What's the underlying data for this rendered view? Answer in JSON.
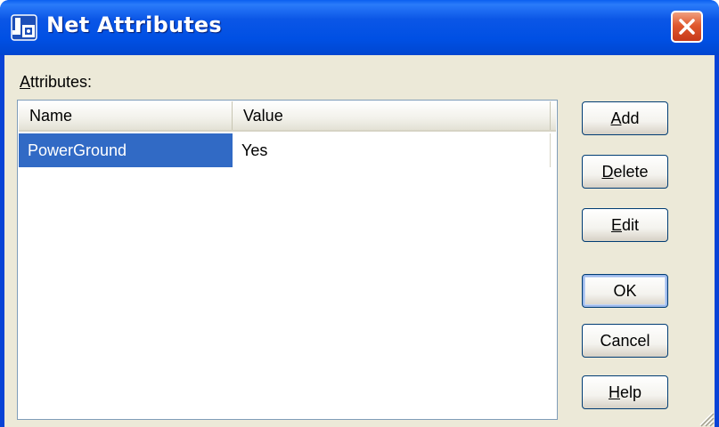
{
  "window": {
    "title": "Net Attributes",
    "app_icon": "app-icon",
    "close_icon": "close-icon"
  },
  "attributes_label": {
    "mnemonic": "A",
    "rest": "ttributes:"
  },
  "list": {
    "columns": [
      "Name",
      "Value"
    ],
    "rows": [
      {
        "name": "PowerGround",
        "value": "Yes",
        "selected": true
      }
    ]
  },
  "buttons": {
    "add": {
      "mnemonic": "A",
      "rest": "dd"
    },
    "delete": {
      "mnemonic": "D",
      "rest": "elete"
    },
    "edit": {
      "mnemonic": "E",
      "rest": "dit"
    },
    "ok": {
      "label": "OK"
    },
    "cancel": {
      "label": "Cancel"
    },
    "help": {
      "mnemonic": "H",
      "rest": "elp"
    }
  },
  "colors": {
    "title_bar": "#0054e3",
    "selection": "#316ac5",
    "dialog_bg": "#ece9d8",
    "close_button": "#e0592e"
  }
}
